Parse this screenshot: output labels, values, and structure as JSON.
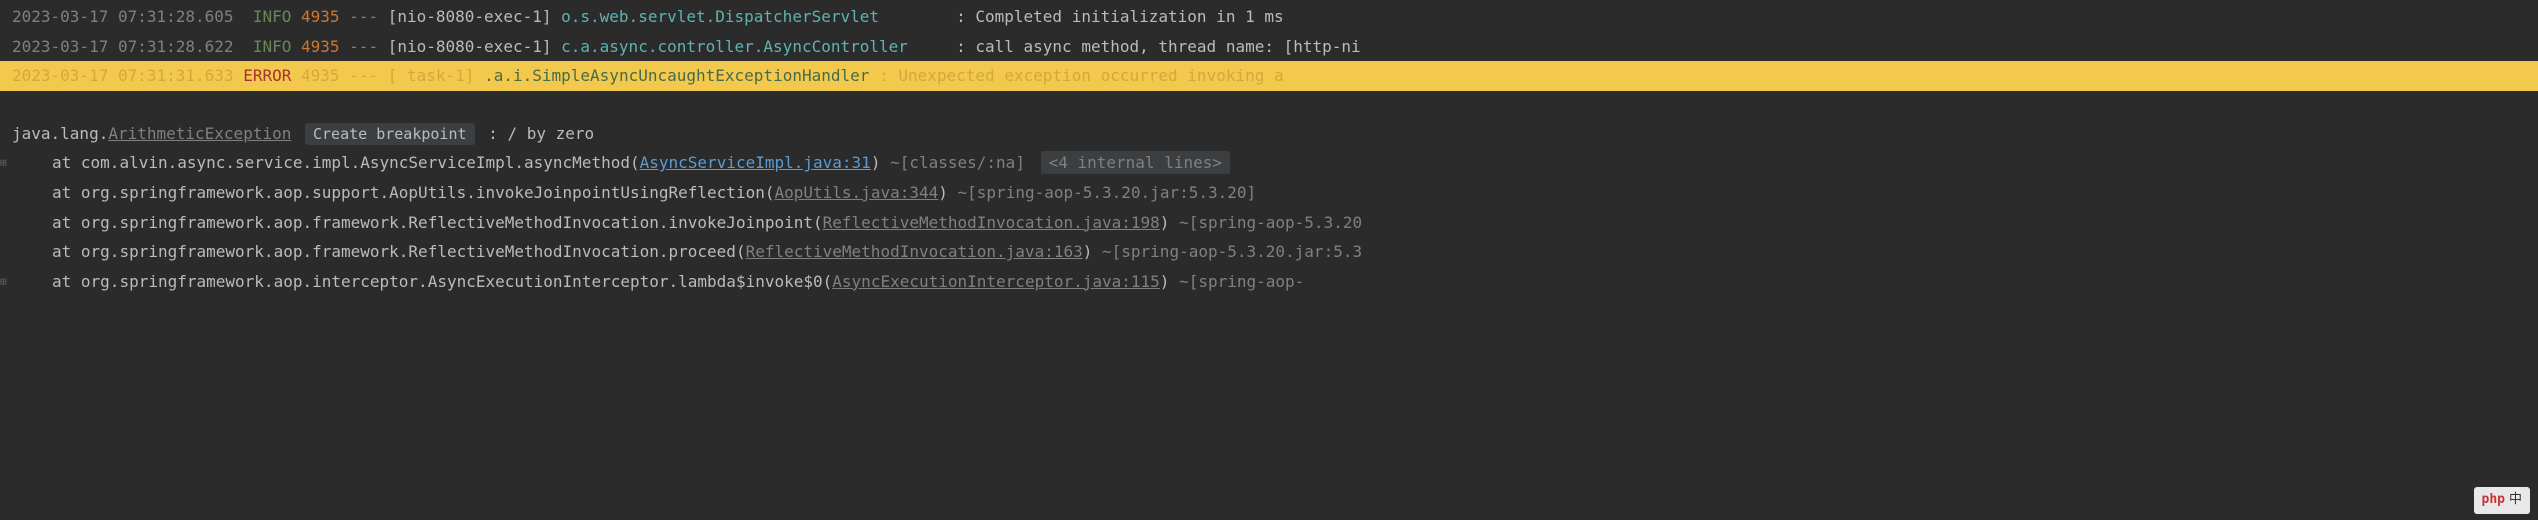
{
  "logs": [
    {
      "timestamp": "2023-03-17 07:31:28.605",
      "level": "INFO",
      "pid": "4935",
      "sep": "---",
      "thread": "[nio-8080-exec-1]",
      "logger": "o.s.web.servlet.DispatcherServlet",
      "colon": ":",
      "message": "Completed initialization in 1 ms"
    },
    {
      "timestamp": "2023-03-17 07:31:28.622",
      "level": "INFO",
      "pid": "4935",
      "sep": "---",
      "thread": "[nio-8080-exec-1]",
      "logger": "c.a.async.controller.AsyncController",
      "colon": ":",
      "message": "call async method, thread name: [http-ni"
    },
    {
      "timestamp": "2023-03-17 07:31:31.633",
      "level": "ERROR",
      "pid": "4935",
      "sep": "---",
      "thread": "[         task-1]",
      "logger": ".a.i.SimpleAsyncUncaughtExceptionHandler",
      "colon": ":",
      "message": "Unexpected exception occurred invoking a"
    }
  ],
  "exception": {
    "prefix": "java.lang.",
    "name": "ArithmeticException",
    "breakpoint_label": "Create breakpoint",
    "suffix": ": / by zero"
  },
  "stack": [
    {
      "at": "at ",
      "method": "com.alvin.async.service.impl.AsyncServiceImpl.asyncMethod",
      "open": "(",
      "source": "AsyncServiceImpl.java:31",
      "close": ")",
      "jar": " ~[classes/:na]",
      "internal": "<4 internal lines>",
      "is_link": true
    },
    {
      "at": "at ",
      "method": "org.springframework.aop.support.AopUtils.invokeJoinpointUsingReflection",
      "open": "(",
      "source": "AopUtils.java:344",
      "close": ")",
      "jar": " ~[spring-aop-5.3.20.jar:5.3.20]",
      "is_link": false
    },
    {
      "at": "at ",
      "method": "org.springframework.aop.framework.ReflectiveMethodInvocation.invokeJoinpoint",
      "open": "(",
      "source": "ReflectiveMethodInvocation.java:198",
      "close": ")",
      "jar": " ~[spring-aop-5.3.20",
      "is_link": false
    },
    {
      "at": "at ",
      "method": "org.springframework.aop.framework.ReflectiveMethodInvocation.proceed",
      "open": "(",
      "source": "ReflectiveMethodInvocation.java:163",
      "close": ")",
      "jar": " ~[spring-aop-5.3.20.jar:5.3",
      "is_link": false
    },
    {
      "at": "at ",
      "method": "org.springframework.aop.interceptor.AsyncExecutionInterceptor.lambda$invoke$0",
      "open": "(",
      "source": "AsyncExecutionInterceptor.java:115",
      "close": ")",
      "jar": " ~[spring-aop-",
      "is_link": false
    }
  ],
  "watermark": {
    "text": "php"
  }
}
